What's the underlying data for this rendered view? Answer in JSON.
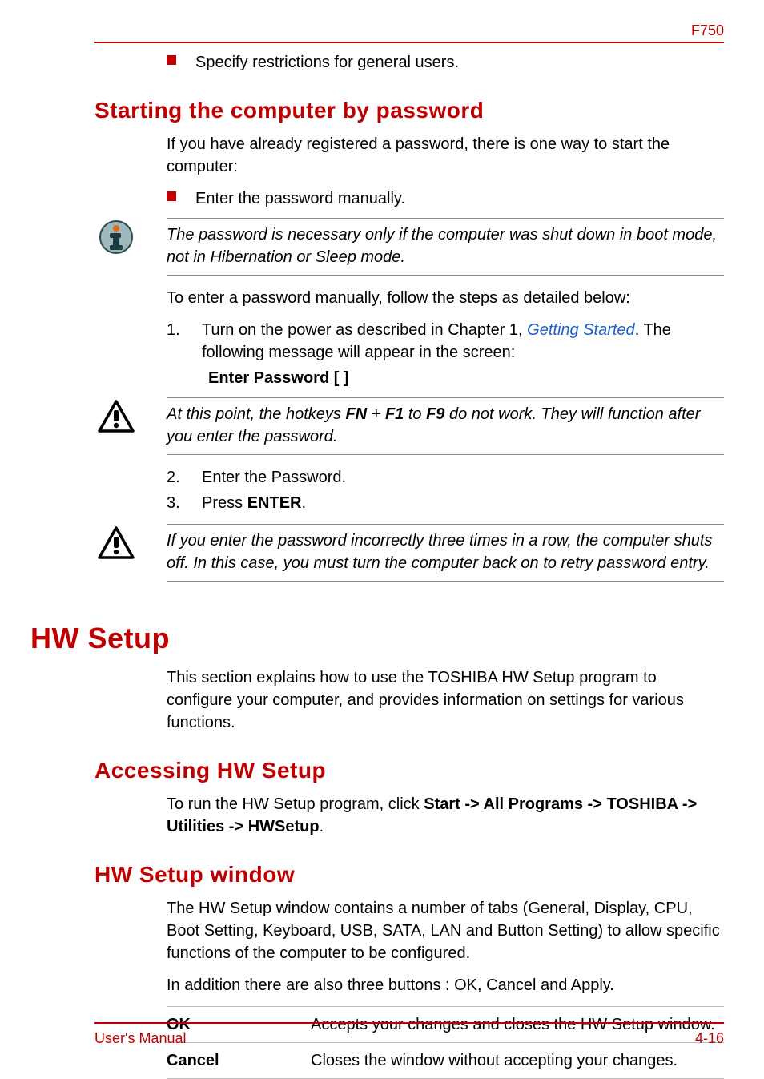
{
  "header": {
    "model": "F750"
  },
  "bullets": {
    "general_users": "Specify restrictions for general users."
  },
  "sections": {
    "start_pw": {
      "title": "Starting the computer by password",
      "intro": "If you have already registered a password, there is one way to start the computer:",
      "bullet1": "Enter the password manually.",
      "note1": "The password is necessary only if the computer was shut down in boot mode, not in Hibernation or Sleep mode.",
      "para2": "To enter a password manually, follow the steps as detailed below:",
      "step1_pre": "Turn on the power as described in Chapter 1, ",
      "step1_link": "Getting Started",
      "step1_post": ". The following message will appear in the screen:",
      "enter_pw": "Enter Password [ ]",
      "note2_pre": "At this point, the hotkeys ",
      "note2_fn": "FN",
      "note2_plus": " + ",
      "note2_f1": "F1",
      "note2_to": " to ",
      "note2_f9": "F9",
      "note2_post": " do not work. They will function after you enter the password.",
      "step2": "Enter the Password.",
      "step3_pre": "Press ",
      "step3_enter": "ENTER",
      "step3_post": ".",
      "note3": "If you enter the password incorrectly three times in a row, the computer shuts off. In this case, you must turn the computer back on to retry password entry."
    },
    "hw": {
      "title": "HW Setup",
      "intro": "This section explains how to use the TOSHIBA HW Setup program to configure your computer, and provides information on settings for various functions.",
      "access_title": "Accessing HW Setup",
      "access_pre": "To run the HW Setup program, click ",
      "access_path": "Start -> All Programs -> TOSHIBA -> Utilities -> HWSetup",
      "access_post": ".",
      "window_title": "HW Setup window",
      "window_p1": "The HW Setup window contains a number of tabs (General, Display, CPU, Boot Setting, Keyboard, USB, SATA, LAN and Button Setting) to allow specific functions of the computer to be configured.",
      "window_p2": "In addition there are also three buttons : OK, Cancel and Apply.",
      "table": [
        {
          "label": "OK",
          "desc": "Accepts your changes and closes the HW Setup window."
        },
        {
          "label": "Cancel",
          "desc": "Closes the window without accepting your changes."
        }
      ]
    }
  },
  "footer": {
    "left": "User's Manual",
    "right": "4-16"
  },
  "numbers": {
    "n1": "1.",
    "n2": "2.",
    "n3": "3."
  }
}
